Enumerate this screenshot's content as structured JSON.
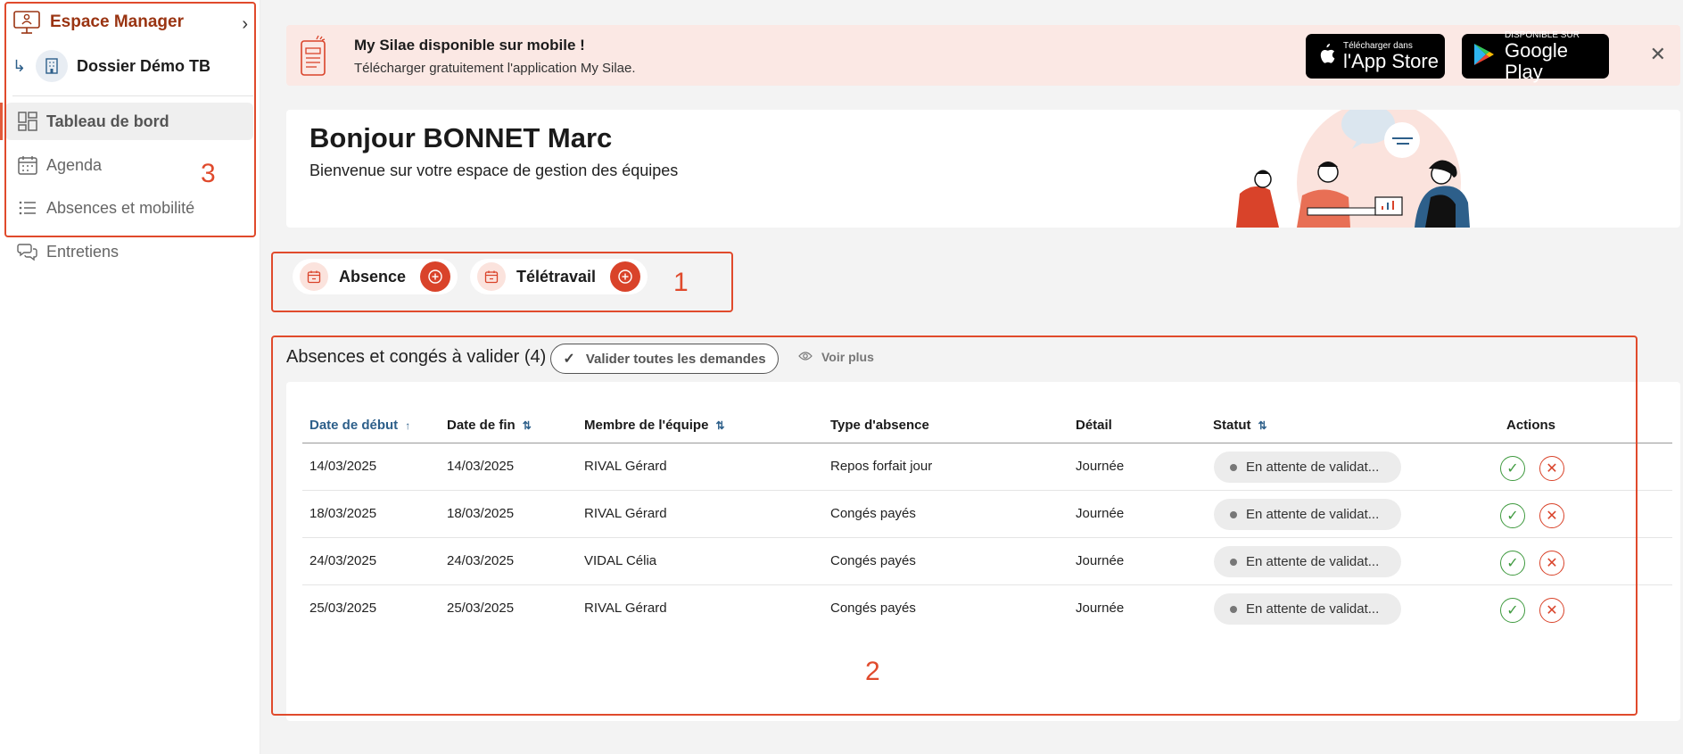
{
  "sidebar": {
    "espace_label": "Espace Manager",
    "dossier_label": "Dossier Démo TB",
    "items": [
      {
        "label": "Tableau de bord"
      },
      {
        "label": "Agenda"
      },
      {
        "label": "Absences et mobilité"
      },
      {
        "label": "Entretiens"
      }
    ]
  },
  "banner": {
    "title": "My Silae disponible sur mobile !",
    "subtitle": "Télécharger gratuitement l'application My Silae.",
    "appstore_small": "Télécharger dans",
    "appstore_big": "l'App Store",
    "googleplay_small": "DISPONIBLE SUR",
    "googleplay_big": "Google Play"
  },
  "hero": {
    "greeting": "Bonjour BONNET Marc",
    "subtitle": "Bienvenue sur votre espace de gestion des équipes"
  },
  "quick_actions": [
    {
      "label": "Absence"
    },
    {
      "label": "Télétravail"
    }
  ],
  "section": {
    "title": "Absences et congés à valider (4)",
    "validate_all_label": "Valider toutes les demandes",
    "see_more_label": "Voir plus"
  },
  "table": {
    "headers": [
      "Date de début",
      "Date de fin",
      "Membre de l'équipe",
      "Type d'absence",
      "Détail",
      "Statut",
      "Actions"
    ],
    "rows": [
      {
        "start": "14/03/2025",
        "end": "14/03/2025",
        "member": "RIVAL Gérard",
        "type": "Repos forfait jour",
        "detail": "Journée",
        "status": "En attente de validat..."
      },
      {
        "start": "18/03/2025",
        "end": "18/03/2025",
        "member": "RIVAL Gérard",
        "type": "Congés payés",
        "detail": "Journée",
        "status": "En attente de validat..."
      },
      {
        "start": "24/03/2025",
        "end": "24/03/2025",
        "member": "VIDAL Célia",
        "type": "Congés payés",
        "detail": "Journée",
        "status": "En attente de validat..."
      },
      {
        "start": "25/03/2025",
        "end": "25/03/2025",
        "member": "RIVAL Gérard",
        "type": "Congés payés",
        "detail": "Journée",
        "status": "En attente de validat..."
      }
    ]
  },
  "annotations": {
    "n1": "1",
    "n2": "2",
    "n3": "3"
  },
  "colors": {
    "accent": "#d9432a",
    "annotation": "#e04a2c",
    "link": "#2d5f8a",
    "banner_bg": "#fbe8e4"
  }
}
